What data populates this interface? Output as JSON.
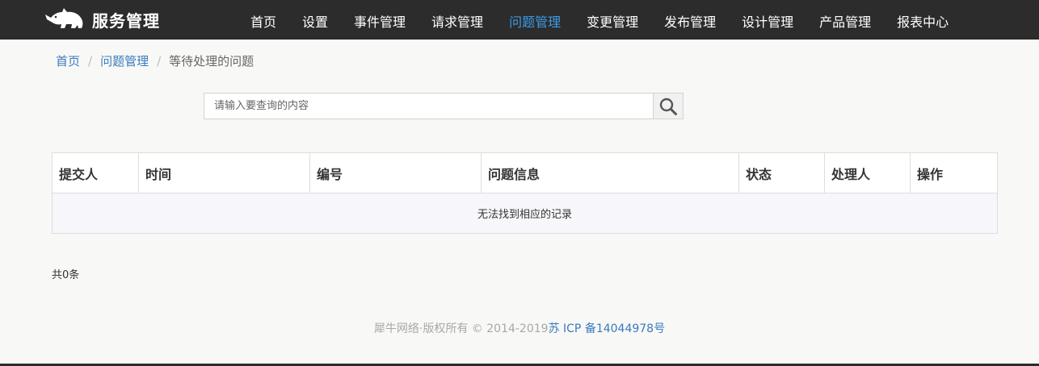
{
  "header": {
    "brand_text": "服务管理",
    "logo_icon": "rhino-logo-icon",
    "nav_items": [
      {
        "label": "首页",
        "active": false
      },
      {
        "label": "设置",
        "active": false
      },
      {
        "label": "事件管理",
        "active": false
      },
      {
        "label": "请求管理",
        "active": false
      },
      {
        "label": "问题管理",
        "active": true
      },
      {
        "label": "变更管理",
        "active": false
      },
      {
        "label": "发布管理",
        "active": false
      },
      {
        "label": "设计管理",
        "active": false
      },
      {
        "label": "产品管理",
        "active": false
      },
      {
        "label": "报表中心",
        "active": false
      }
    ],
    "colors": {
      "background": "#2c2c2c",
      "active": "#3d9be6",
      "text": "#ffffff"
    }
  },
  "breadcrumb": {
    "items": [
      {
        "label": "首页"
      },
      {
        "label": "问题管理"
      }
    ],
    "separator": "/",
    "current": "等待处理的问题"
  },
  "search": {
    "value": "",
    "placeholder": "请输入要查询的内容",
    "icon": "search-icon"
  },
  "table": {
    "columns": [
      "提交人",
      "时间",
      "编号",
      "问题信息",
      "状态",
      "处理人",
      "操作"
    ],
    "rows": [],
    "empty_text": "无法找到相应的记录"
  },
  "pagination": {
    "total_text": "共0条"
  },
  "footer": {
    "copyright": "犀牛网络·版权所有 © 2014-2019",
    "icp": "苏 ICP 备14044978号"
  }
}
